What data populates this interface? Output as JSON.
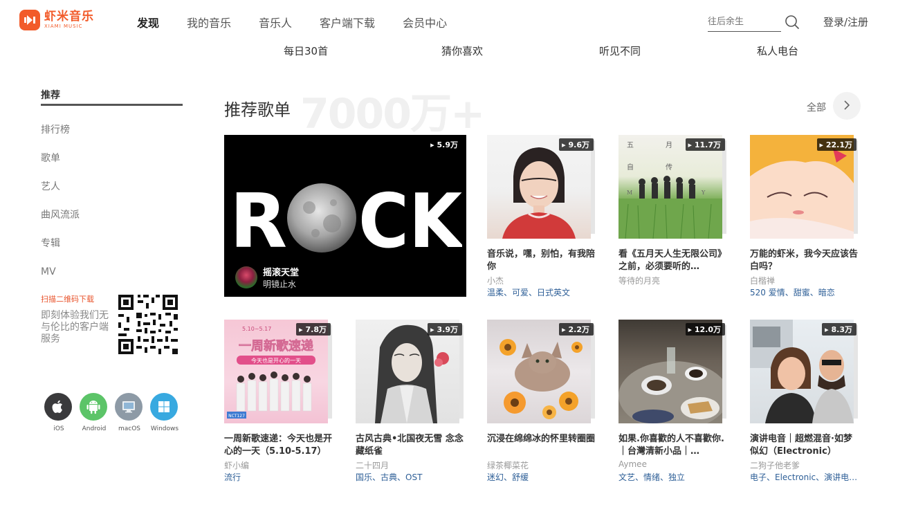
{
  "header": {
    "logo_cn": "虾米音乐",
    "logo_en": "XIAMI MUSIC",
    "nav": [
      "发现",
      "我的音乐",
      "音乐人",
      "客户端下载",
      "会员中心"
    ],
    "search_placeholder": "往后余生",
    "login": "登录/注册"
  },
  "subnav": [
    "每日30首",
    "猜你喜欢",
    "听见不同",
    "私人电台"
  ],
  "sidebar": {
    "items": [
      "推荐",
      "排行榜",
      "歌单",
      "艺人",
      "曲风流派",
      "专辑",
      "MV"
    ],
    "qr_title": "扫描二维码下载",
    "qr_desc": "即刻体验我们无与伦比的客户端服务",
    "apps": [
      "iOS",
      "Android",
      "macOS",
      "Windows"
    ]
  },
  "main": {
    "section_title": "推荐歌单",
    "bg_number": "7000万+",
    "all_label": "全部",
    "feature": {
      "plays": "5.9万",
      "title": "摇滚天堂",
      "subtitle": "明镜止水",
      "art_text": "ROCK"
    },
    "cards": [
      {
        "plays": "9.6万",
        "title": "音乐说，嘿，别怕，有我陪你",
        "author": "小杰",
        "tags": "温柔、可爱、日式英文"
      },
      {
        "plays": "11.7万",
        "title": "看《五月天人生无限公司》之前，必须要听的…",
        "author": "等待的月亮",
        "tags": ""
      },
      {
        "plays": "22.1万",
        "title": "万能的虾米，我今天应该告白吗？",
        "author": "白楷禅",
        "tags": "520 爱情、甜蜜、暗恋"
      },
      {
        "plays": "7.8万",
        "title": "一周新歌速递：今天也是开心的一天（5.10-5.17）",
        "author": "虾小编",
        "tags": "流行"
      },
      {
        "plays": "3.9万",
        "title": "古风古典•北国夜无雪 念念藏纸雀",
        "author": "二十四月",
        "tags": "国乐、古典、OST"
      },
      {
        "plays": "2.2万",
        "title": "沉浸在绵绵冰的怀里转圈圈",
        "author": "绿茶椰菜花",
        "tags": "迷幻、舒缓"
      },
      {
        "plays": "12.0万",
        "title": "如果.你喜歡的人不喜歡你.｜台灣清新小品｜…",
        "author": "Aymee",
        "tags": "文艺、情绪、独立"
      },
      {
        "plays": "8.3万",
        "title": "演讲电音｜超燃混音·如梦似幻（Electronic）",
        "author": "二狗子他老爹",
        "tags": "电子、Electronic、演讲电…"
      }
    ],
    "cover_texts": {
      "card2": [
        "五",
        "月",
        "自",
        "传",
        "M",
        "Y"
      ],
      "card4_date": "5.10~5.17",
      "card4_title": "一周新歌速递",
      "card4_sub": "今天也是开心的一天",
      "card4_tag": "NCT127"
    }
  },
  "colors": {
    "brand": "#f25b2a",
    "tag_link": "#2e5f97",
    "ios": "#3a3a3c",
    "android": "#5cc468",
    "macos": "#8d9aa6",
    "windows": "#38a9e0"
  }
}
